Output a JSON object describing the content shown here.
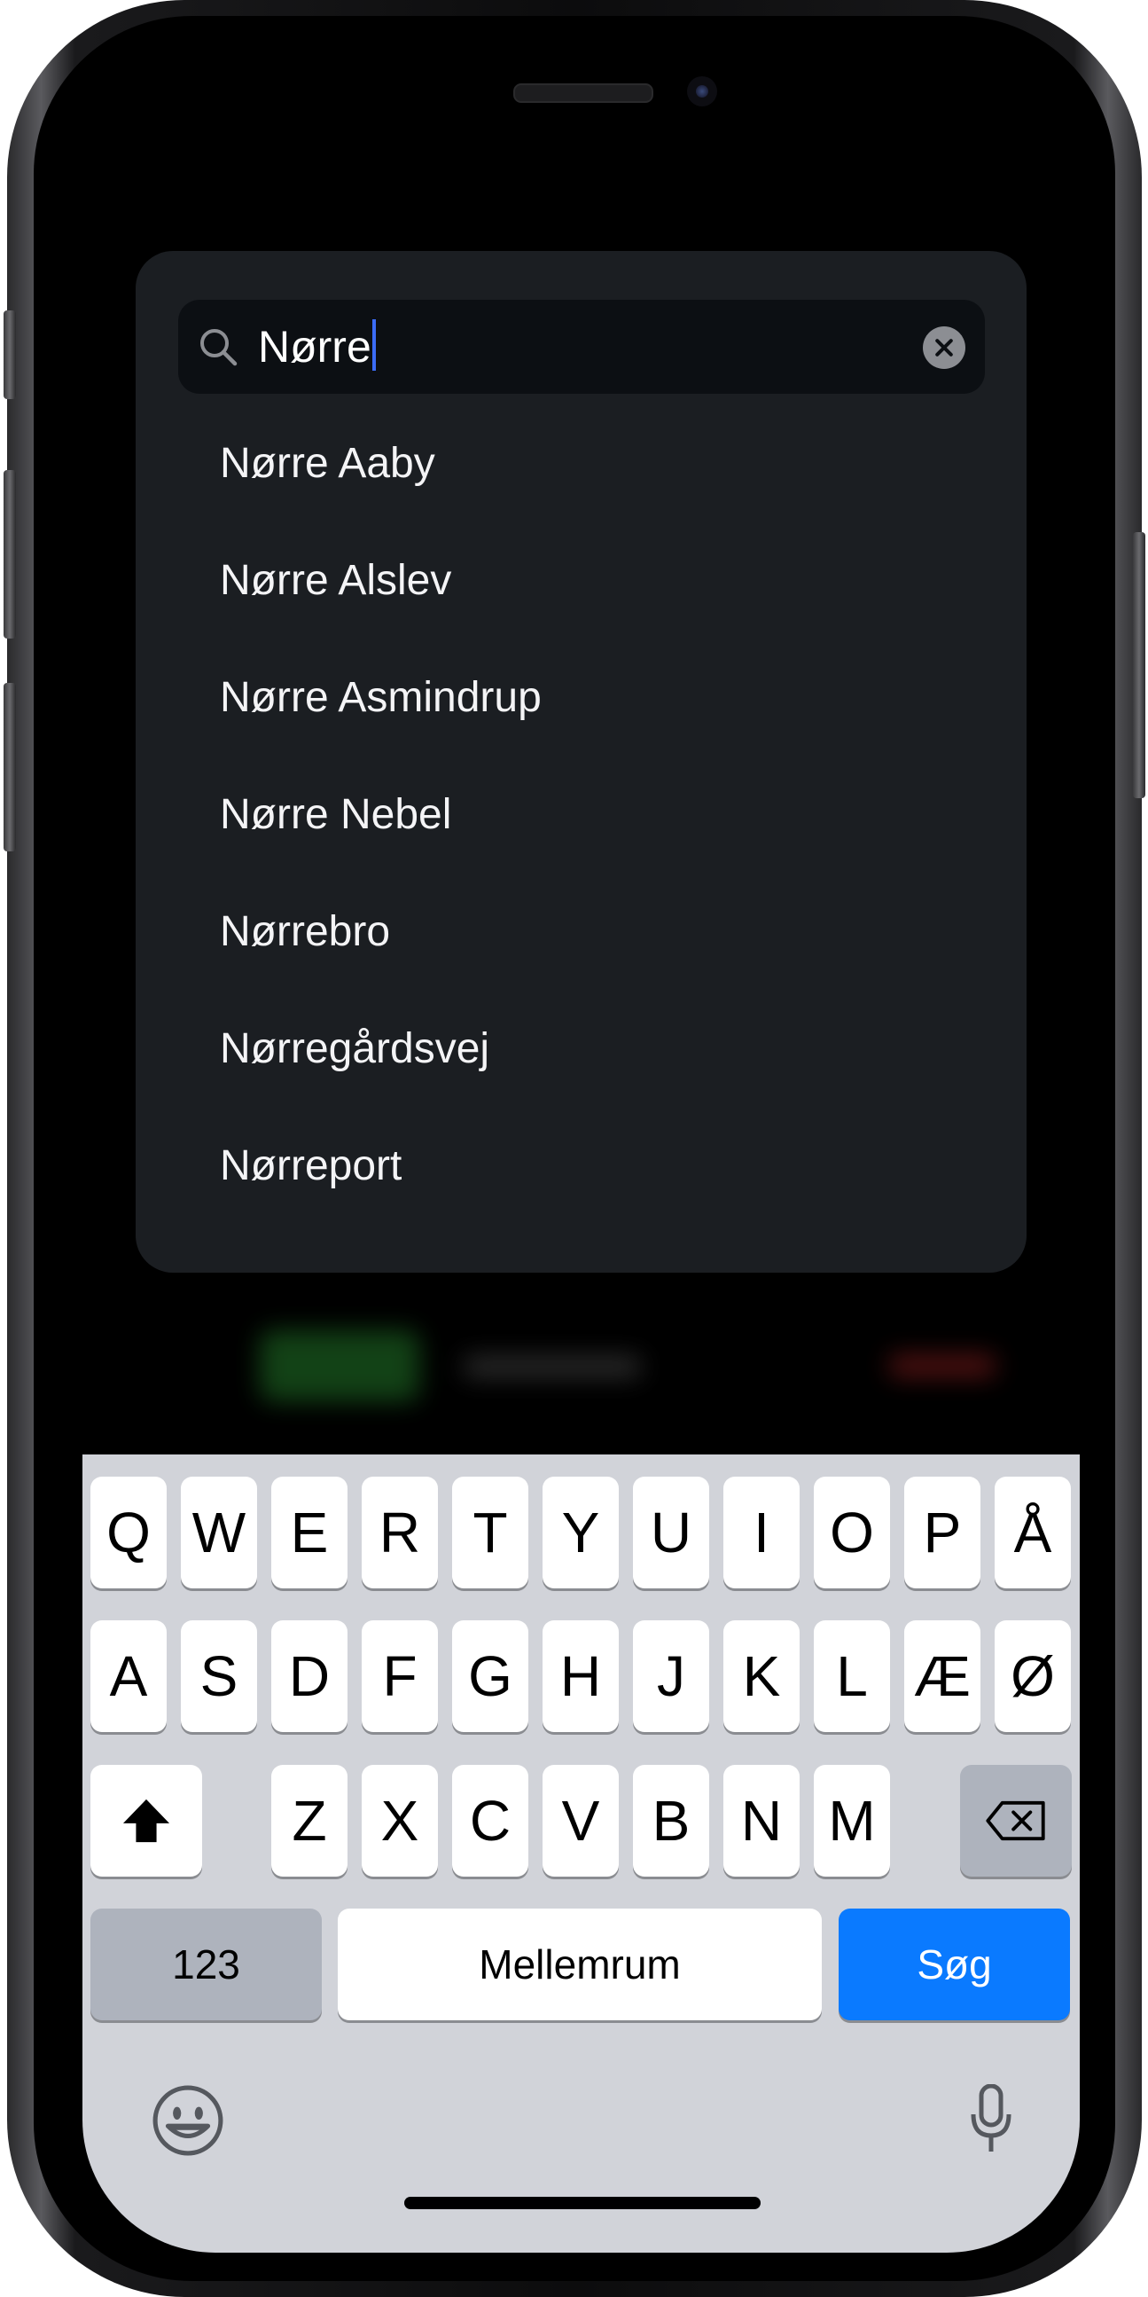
{
  "search": {
    "query": "Nørre",
    "clear_icon": "clear-circle-icon"
  },
  "results": [
    "Nørre Aaby",
    "Nørre Alslev",
    "Nørre Asmindrup",
    "Nørre Nebel",
    "Nørrebro",
    "Nørregårdsvej",
    "Nørreport"
  ],
  "keyboard": {
    "row1": [
      "Q",
      "W",
      "E",
      "R",
      "T",
      "Y",
      "U",
      "I",
      "O",
      "P",
      "Å"
    ],
    "row2": [
      "A",
      "S",
      "D",
      "F",
      "G",
      "H",
      "J",
      "K",
      "L",
      "Æ",
      "Ø"
    ],
    "row3": [
      "Z",
      "X",
      "C",
      "V",
      "B",
      "N",
      "M"
    ],
    "numbers_label": "123",
    "space_label": "Mellemrum",
    "search_label": "Søg",
    "shift_icon": "shift-icon",
    "backspace_icon": "backspace-icon",
    "emoji_icon": "emoji-icon",
    "mic_icon": "microphone-icon"
  },
  "colors": {
    "panel": "#1b1e22",
    "search_field": "#0c0f13",
    "caret": "#3b6cf6",
    "search_key": "#0a7aff",
    "keyboard_bg": "#d1d3d9"
  }
}
